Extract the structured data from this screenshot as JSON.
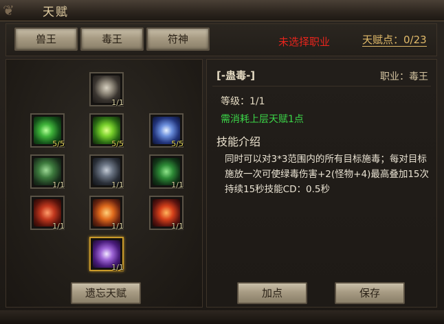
{
  "window": {
    "title": "天赋"
  },
  "tabs": [
    {
      "label": "兽王"
    },
    {
      "label": "毒王"
    },
    {
      "label": "符神"
    }
  ],
  "header": {
    "class_status": "未选择职业",
    "talent_points": "天赋点：0/23"
  },
  "tree": {
    "nodes": [
      {
        "id": "skull",
        "level": "1/1",
        "icon": "skull-icon"
      },
      {
        "id": "green-swirl-1",
        "level": "5/5",
        "icon": "green-swirl-icon"
      },
      {
        "id": "green-swirl-2",
        "level": "5/5",
        "icon": "green-vortex-icon"
      },
      {
        "id": "blue-swirl",
        "level": "5/5",
        "icon": "blue-swirl-icon"
      },
      {
        "id": "green-wisp",
        "level": "1/1",
        "icon": "green-wisp-icon"
      },
      {
        "id": "dark-spirit",
        "level": "1/1",
        "icon": "dark-spirit-icon"
      },
      {
        "id": "green-beast",
        "level": "1/1",
        "icon": "green-beast-icon"
      },
      {
        "id": "red-rune",
        "level": "1/1",
        "icon": "red-rune-icon"
      },
      {
        "id": "fire-rune",
        "level": "1/1",
        "icon": "fire-rune-icon"
      },
      {
        "id": "fire-demon",
        "level": "1/1",
        "icon": "fire-demon-icon"
      },
      {
        "id": "purple-skulls",
        "level": "1/1",
        "icon": "purple-skulls-icon"
      }
    ],
    "forget_label": "遗忘天赋"
  },
  "detail": {
    "skill_name": "[-蛊毒-]",
    "class_label": "职业：毒王",
    "level": "等级：1/1",
    "cost": "需消耗上层天赋1点",
    "intro_heading": "技能介绍",
    "description": "同时可以对3*3范围内的所有目标施毒；每对目标施放一次可使绿毒伤害+2(怪物+4)最高叠加15次持续15秒技能CD：0.5秒",
    "add_label": "加点",
    "save_label": "保存"
  },
  "colors": {
    "accent_red": "#e8241c",
    "gold": "#e2bb6a",
    "green": "#3bd548"
  }
}
